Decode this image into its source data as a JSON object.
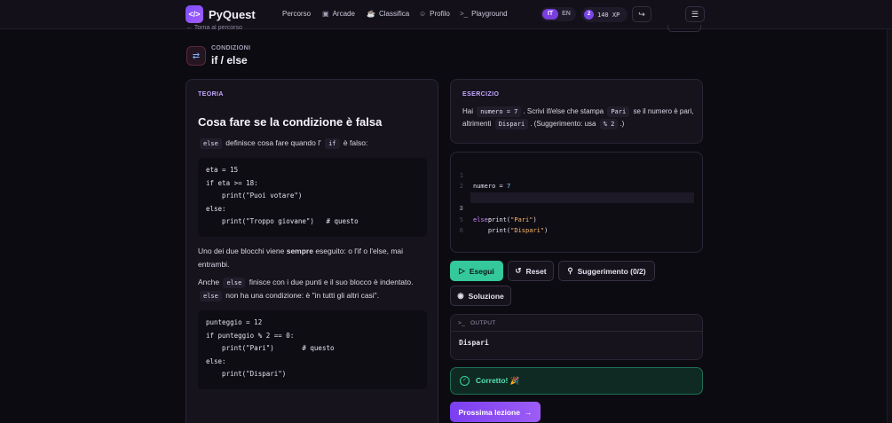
{
  "nav": {
    "logo_glyph": "</>",
    "brand": "PyQuest",
    "links": [
      {
        "label": "Percorso",
        "icon": ""
      },
      {
        "label": "Arcade",
        "icon": "gamepad-icon"
      },
      {
        "label": "Classifica",
        "icon": "trophy-icon"
      },
      {
        "label": "Profilo",
        "icon": "user-icon"
      },
      {
        "label": "Playground",
        "icon": "terminal-icon"
      }
    ],
    "lang_active": "IT",
    "lang_other": "EN",
    "xp_badge": "2",
    "xp_value": "140 XP"
  },
  "header": {
    "back_text": "← Torna al percorso",
    "kicker": "CONDIZIONI",
    "title": "if / else"
  },
  "theory": {
    "label": "TEORIA",
    "title": "Cosa fare se la condizione è falsa",
    "p1_code1": "else",
    "p1_text1": "definisce cosa fare quando l'",
    "p1_code2": "if",
    "p1_text2": "è falso:",
    "code1": [
      "eta = 15",
      "if eta >= 18:",
      "    print(\"Puoi votare\")",
      "else:",
      "    print(\"Troppo giovane\")   # questo"
    ],
    "p2_a": "Uno dei due blocchi viene ",
    "p2_bold": "sempre",
    "p2_b": " eseguito: o l'if o l'else, mai entrambi.",
    "p3_a": "Anche",
    "p3_code1": "else",
    "p3_b": "finisce con i due punti e il suo blocco è indentato.",
    "p3_code2": "else",
    "p3_c": "non ha una condizione: è \"in tutti gli altri casi\".",
    "code2": [
      "punteggio = 12",
      "if punteggio % 2 == 0:",
      "    print(\"Pari\")       # questo",
      "else:",
      "    print(\"Dispari\")"
    ]
  },
  "exercise": {
    "label": "ESERCIZIO",
    "t1": "Hai",
    "c1": "numero = 7",
    "t2": ". Scrivi if/else che stampa",
    "c2": "Pari",
    "t3": "se il numero è pari, altrimenti",
    "c3": "Dispari",
    "t4": ". (Suggerimento: usa",
    "c4": "% 2",
    "t5": ".)"
  },
  "editor": {
    "lines": [
      "1",
      "2",
      "3",
      "4",
      "5",
      "6"
    ],
    "current_line": 3
  },
  "buttons": {
    "run": "Esegui",
    "reset": "Reset",
    "hint": "Suggerimento (0/2)",
    "solution": "Soluzione",
    "next": "Prossima lezione"
  },
  "output": {
    "label": "OUTPUT",
    "value": "Dispari"
  },
  "result": {
    "text": "Corretto! 🎉"
  }
}
